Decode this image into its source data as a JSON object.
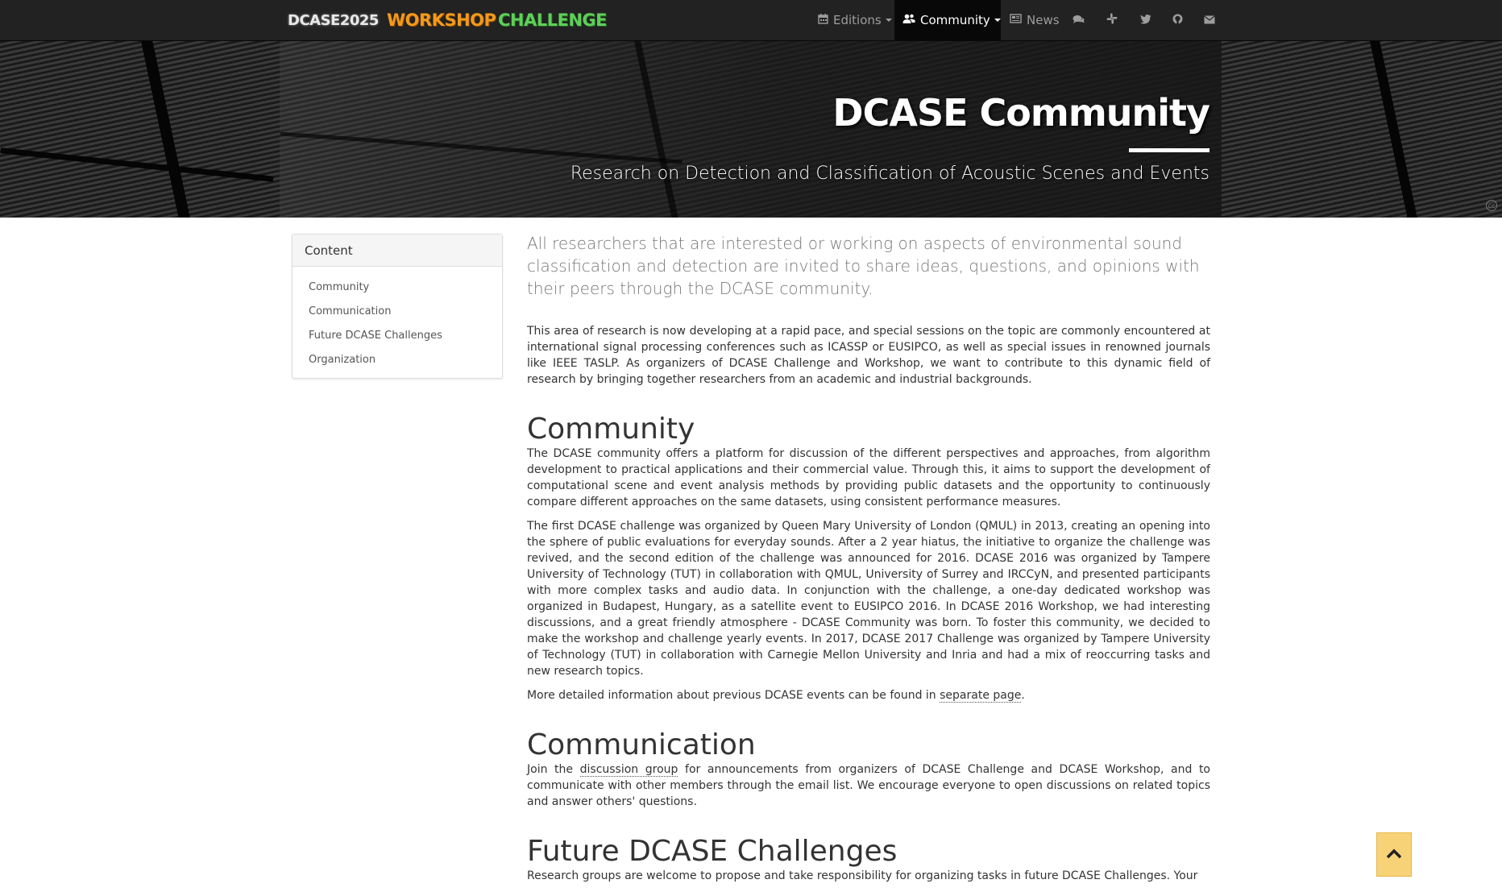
{
  "nav": {
    "brand_dcase": "DCASE2025",
    "brand_workshop": "WORKSHOP",
    "brand_challenge": "CHALLENGE",
    "editions_label": "Editions",
    "community_label": "Community",
    "news_label": "News"
  },
  "hero": {
    "title": "DCASE Community",
    "subtitle": "Research on Detection and Classification of Acoustic Scenes and Events",
    "cc_badge": "cc"
  },
  "toc": {
    "heading": "Content",
    "items": [
      "Community",
      "Communication",
      "Future DCASE Challenges",
      "Organization"
    ]
  },
  "main": {
    "lead": "All researchers that are interested or working on aspects of environmental sound classification and detection are invited to share ideas, questions, and opinions with their peers through the DCASE community.",
    "intro": "This area of research is now developing at a rapid pace, and special sessions on the topic are commonly encountered at international signal processing conferences such as ICASSP or EUSIPCO, as well as special issues in renowned journals like IEEE TASLP. As organizers of DCASE Challenge and Workshop, we want to contribute to this dynamic field of research by bringing together researchers from an academic and industrial backgrounds.",
    "community_heading": "Community",
    "community_p1": "The DCASE community offers a platform for discussion of the different perspectives and approaches, from algorithm development to practical applications and their commercial value. Through this, it aims to support the development of computational scene and event analysis methods by providing public datasets and the opportunity to continuously compare different approaches on the same datasets, using consistent performance measures.",
    "community_p2": "The first DCASE challenge was organized by Queen Mary University of London (QMUL) in 2013, creating an opening into the sphere of public evaluations for everyday sounds. After a 2 year hiatus, the initiative to organize the challenge was revived, and the second edition of the challenge was announced for 2016. DCASE 2016 was organized by Tampere University of Technology (TUT) in collaboration with QMUL, University of Surrey and IRCCyN, and presented participants with more complex tasks and audio data. In conjunction with the challenge, a one-day dedicated workshop was organized in Budapest, Hungary, as a satellite event to EUSIPCO 2016. In DCASE 2016 Workshop, we had interesting discussions, and a great friendly atmosphere - DCASE Community was born. To foster this community, we decided to make the workshop and challenge yearly events. In 2017, DCASE 2017 Challenge was organized by Tampere University of Technology (TUT) in collaboration with Carnegie Mellon University and Inria and had a mix of reoccurring tasks and new research topics.",
    "community_p3_before": "More detailed information about previous DCASE events can be found in ",
    "community_p3_link": "separate page",
    "community_p3_after": ".",
    "communication_heading": "Communication",
    "communication_before": "Join the ",
    "communication_link": "discussion group",
    "communication_after": " for announcements from organizers of DCASE Challenge and DCASE Workshop, and to communicate with other members through the email list. We encourage everyone to open discussions on related topics and answer others' questions.",
    "future_heading": "Future DCASE Challenges",
    "future_p1": "Research groups are welcome to propose and take responsibility for organizing tasks in future DCASE Challenges. Your"
  },
  "colors": {
    "navbar_bg": "#222222",
    "workshop_orange": "#f39a1a",
    "challenge_green": "#5fcf5a",
    "to_top_bg": "#f7d277"
  },
  "icons": [
    "calendar-icon",
    "users-icon",
    "newspaper-icon",
    "comments-icon",
    "slack-icon",
    "twitter-icon",
    "github-icon",
    "envelope-icon",
    "chevron-up-icon",
    "creative-commons-icon"
  ]
}
